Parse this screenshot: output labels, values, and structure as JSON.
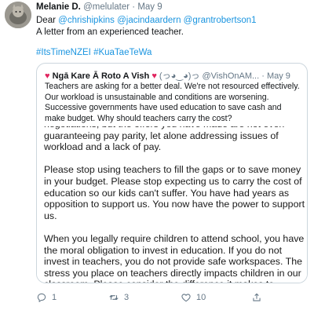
{
  "tweet": {
    "author_name": "Melanie D.",
    "author_handle": "@melulater",
    "separator": "·",
    "time": "May 9",
    "greeting": "Dear",
    "mentions": [
      "@chrishipkins",
      "@jacindaardern",
      "@grantrobertson1"
    ],
    "text": "A letter from an experienced teacher.",
    "hashtags": [
      "#ItsTimeNZEI",
      "#KuaTaeTeWa"
    ]
  },
  "quote": {
    "heart_left": "♥",
    "name": "Ngā Kare Ā Roto A Vish",
    "heart_right": "♥",
    "emoticon": "(っ◕‿◕)っ",
    "handle": "@VishOnAM...",
    "separator": "·",
    "time": "May 9",
    "text": "Teachers are asking for a better deal. We're not resourced effectively. Our workload is unsustainable and conditions are worsening. Successive governments have used education to save cash and make budget. Why should teachers carry the cost?",
    "letter_paragraphs": [
      "negotiations, but the offers you have made are not even guaranteeing pay parity, let alone addressing issues of workload and a lack of pay.",
      "Please stop using teachers to fill the gaps or to save money in your budget. Please stop expecting us to carry the cost of education so our kids can't suffer. You have had years as opposition to support us. You now have the power to support us.",
      "When you legally require children to attend school, you have the moral obligation to invest in education. If you do not invest in teachers, you do not provide safe workspaces. The stress you place on teachers directly impacts children in our classroom. Please consider the difference it makes to"
    ]
  },
  "actions": {
    "reply_count": "1",
    "retweet_count": "3",
    "like_count": "10"
  },
  "colors": {
    "link": "#1b95e0",
    "muted": "#657786",
    "heart": "#e0245e",
    "border": "#ccd6dd"
  }
}
